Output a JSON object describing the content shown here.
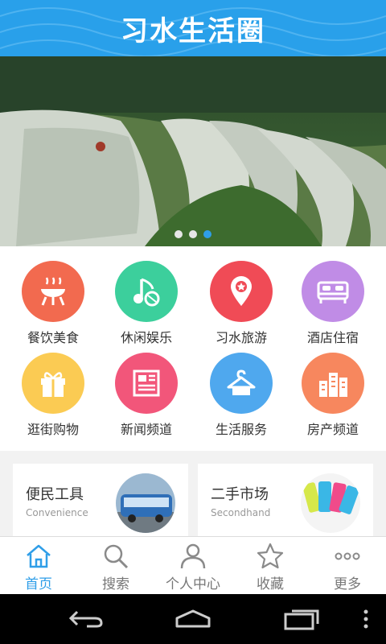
{
  "header": {
    "title": "习水生活圈"
  },
  "banner": {
    "slides": 3,
    "active_slide": 3
  },
  "categories": [
    {
      "label": "餐饮美食",
      "icon": "bbq-grill-icon",
      "color": "#f26a4f"
    },
    {
      "label": "休闲娱乐",
      "icon": "music-note-icon",
      "color": "#3ccf9c"
    },
    {
      "label": "习水旅游",
      "icon": "location-pin-icon",
      "color": "#f04b56"
    },
    {
      "label": "酒店住宿",
      "icon": "bed-icon",
      "color": "#c08ce6"
    },
    {
      "label": "逛街购物",
      "icon": "gift-icon",
      "color": "#fbcb53"
    },
    {
      "label": "新闻频道",
      "icon": "newspaper-icon",
      "color": "#f2567a"
    },
    {
      "label": "生活服务",
      "icon": "hanger-icon",
      "color": "#4fa8ee"
    },
    {
      "label": "房产频道",
      "icon": "buildings-icon",
      "color": "#f7875e"
    }
  ],
  "cards": [
    {
      "title": "便民工具",
      "subtitle": "Convenience",
      "image": "bus-photo"
    },
    {
      "title": "二手市场",
      "subtitle": "Secondhand",
      "image": "phones-photo"
    }
  ],
  "tabs": [
    {
      "label": "首页",
      "icon": "home-icon",
      "active": true
    },
    {
      "label": "搜索",
      "icon": "search-icon",
      "active": false
    },
    {
      "label": "个人中心",
      "icon": "user-icon",
      "active": false
    },
    {
      "label": "收藏",
      "icon": "star-icon",
      "active": false
    },
    {
      "label": "更多",
      "icon": "more-dots-icon",
      "active": false
    }
  ],
  "colors": {
    "accent": "#2f9ee8",
    "header": "#29a0ea",
    "inactive": "#777777"
  }
}
